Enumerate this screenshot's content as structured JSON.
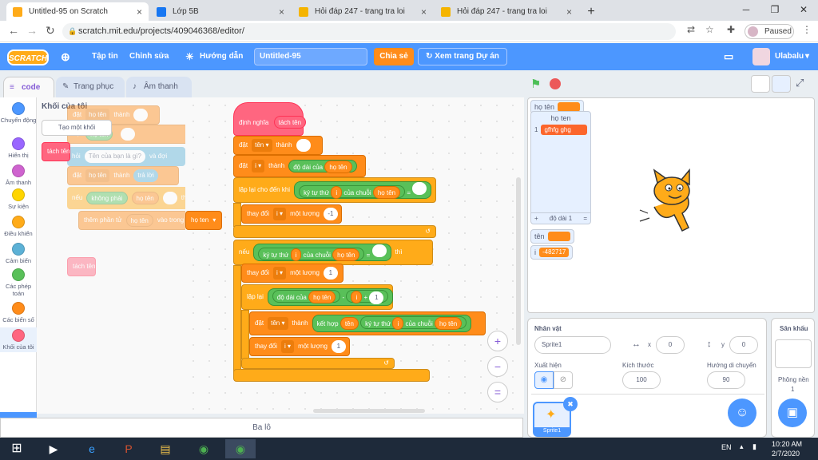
{
  "browser": {
    "tabs": [
      {
        "title": "Untitled-95 on Scratch",
        "color": "#ffab19"
      },
      {
        "title": "Lớp 5B",
        "color": "#1877f2"
      },
      {
        "title": "Hỏi đáp 247 - trang tra loi",
        "color": "#f5b400"
      },
      {
        "title": "Hỏi đáp 247 - trang tra loi",
        "color": "#f5b400"
      }
    ],
    "new_tab": "+",
    "close_glyph": "×",
    "url": "scratch.mit.edu/projects/409046368/editor/",
    "profile_status": "Paused"
  },
  "menu": {
    "logo": "SCRATCH",
    "file": "Tập tin",
    "edit": "Chỉnh sửa",
    "tutorials": "Hướng dẫn",
    "project_title": "Untitled-95",
    "share": "Chia sẻ",
    "see_project": "Xem trang Dự án",
    "username": "Ulabalu"
  },
  "editor_tabs": {
    "code": "code",
    "costumes": "Trang phục",
    "sounds": "Âm thanh"
  },
  "categories": [
    {
      "label": "Chuyển động",
      "color": "#4c97ff"
    },
    {
      "label": "Hiển thị",
      "color": "#9966ff"
    },
    {
      "label": "Âm thanh",
      "color": "#cf63cf"
    },
    {
      "label": "Sự kiện",
      "color": "#ffd500"
    },
    {
      "label": "Điều khiển",
      "color": "#ffab19"
    },
    {
      "label": "Cảm biến",
      "color": "#5cb1d6"
    },
    {
      "label": "Các phép toán",
      "color": "#59c059"
    },
    {
      "label": "Các biến số",
      "color": "#ff8c1a"
    },
    {
      "label": "Khối của tôi",
      "color": "#ff6680"
    }
  ],
  "palette": {
    "heading": "Khối của tôi",
    "make_block": "Tạo một khối",
    "custom_block": "tách tên",
    "ghost_blocks": {
      "set1": "đặt",
      "var_hoten": "họ tên",
      "to": "thành",
      "ask": "hỏi",
      "ask_q": "Tên của bạn là gì?",
      "and_wait": "và đợi",
      "answer": "trả lời",
      "if": "nếu",
      "not_equal": "không phải",
      "then": "thì",
      "add": "thêm phần tử",
      "into": "vào trong",
      "list_hoten": "họ ten",
      "call": "tách tên"
    }
  },
  "script": {
    "define": "định nghĩa",
    "define_name": "tách tên",
    "set": "đặt",
    "to": "thành",
    "var_ten": "tên",
    "var_i": "i",
    "length_of": "độ dài của",
    "var_hoten": "họ tên",
    "repeat_until": "lặp lại cho đến khi",
    "letter": "ký tự thứ",
    "of_string": "của chuỗi",
    "equals": "=",
    "change": "thay đổi",
    "by": "một lượng",
    "minus_one": "-1",
    "one": "1",
    "if": "nếu",
    "then": "thì",
    "repeat": "lặp lại",
    "minus": "-",
    "plus": "+",
    "join": "kết hợp",
    "loop_arrow": "↺"
  },
  "zoom": {
    "in": "+",
    "out": "−",
    "reset": "="
  },
  "stage": {
    "monitor_hoten_label": "họ tên",
    "list_title": "họ ten",
    "list_index": "1",
    "list_item": "gfhfg ghg",
    "list_add": "+",
    "list_length": "độ dài 1",
    "list_eq": "=",
    "monitor_ten_label": "tên",
    "monitor_i_label": "i",
    "monitor_i_value": "-482717"
  },
  "sprite_info": {
    "label_sprite": "Nhân vật",
    "sprite_name": "Sprite1",
    "label_x": "x",
    "x": "0",
    "label_y": "y",
    "y": "0",
    "label_show": "Xuất hiện",
    "label_size": "Kích thước",
    "size": "100",
    "label_direction": "Hướng di chuyển",
    "direction": "90",
    "thumb_name": "Sprite1"
  },
  "stage_panel": {
    "label": "Sân khấu",
    "backdrops_label": "Phông nền",
    "backdrops_count": "1"
  },
  "backpack": "Ba lô",
  "taskbar": {
    "lang": "EN",
    "time": "10:20 AM",
    "date": "2/7/2020"
  }
}
